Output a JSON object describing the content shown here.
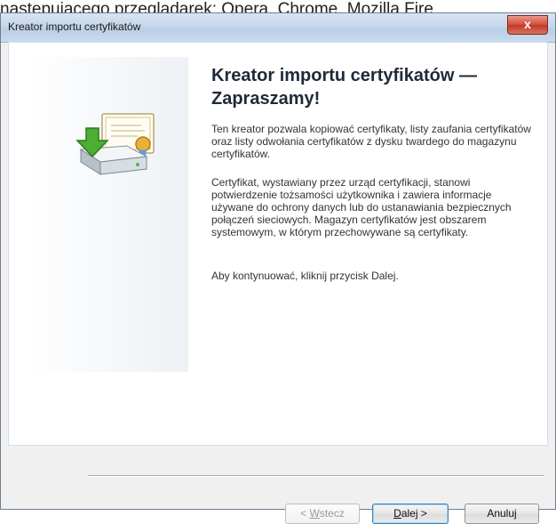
{
  "page_overlap_text": "następującęgo przeglądarek: Opera, Chrome, Mozilla Fire",
  "window": {
    "title": "Kreator importu certyfikatów",
    "close_label": "x"
  },
  "wizard": {
    "heading_line1": "Kreator importu certyfikatów —",
    "heading_line2": "Zapraszamy!",
    "paragraph1": "Ten kreator pozwala kopiować certyfikaty, listy zaufania certyfikatów oraz listy odwołania certyfikatów z dysku twardego do magazynu certyfikatów.",
    "paragraph2": "Certyfikat, wystawiany przez urząd certyfikacji, stanowi potwierdzenie tożsamości użytkownika i zawiera informacje używane do ochrony danych lub do ustanawiania bezpiecznych połączeń sieciowych. Magazyn certyfikatów jest obszarem systemowym, w którym przechowywane są certyfikaty.",
    "paragraph3": "Aby kontynuować, kliknij przycisk Dalej."
  },
  "buttons": {
    "back_prefix": "< ",
    "back_hotkey": "W",
    "back_rest": "stecz",
    "next_hotkey": "D",
    "next_rest": "alej >",
    "cancel": "Anuluj"
  },
  "icons": {
    "wizard_icon": "certificate-import-icon",
    "close_icon": "close-icon"
  }
}
